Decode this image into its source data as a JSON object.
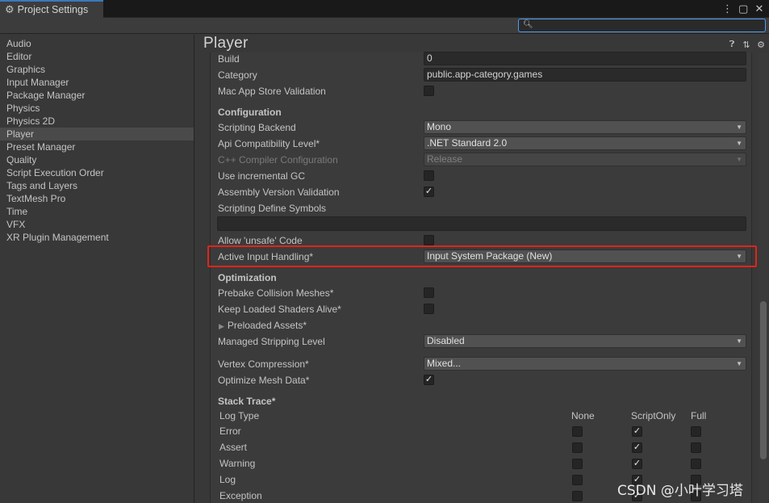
{
  "window": {
    "tab_title": "Project Settings",
    "tab_icon": "gear-icon",
    "controls": [
      "more-icon",
      "maximize-icon",
      "close-icon"
    ]
  },
  "search": {
    "value": "",
    "placeholder": ""
  },
  "sidebar": {
    "items": [
      {
        "label": "Audio"
      },
      {
        "label": "Editor"
      },
      {
        "label": "Graphics"
      },
      {
        "label": "Input Manager"
      },
      {
        "label": "Package Manager"
      },
      {
        "label": "Physics"
      },
      {
        "label": "Physics 2D"
      },
      {
        "label": "Player",
        "selected": true
      },
      {
        "label": "Preset Manager"
      },
      {
        "label": "Quality"
      },
      {
        "label": "Script Execution Order"
      },
      {
        "label": "Tags and Layers"
      },
      {
        "label": "TextMesh Pro"
      },
      {
        "label": "Time"
      },
      {
        "label": "VFX"
      },
      {
        "label": "XR Plugin Management"
      }
    ]
  },
  "main": {
    "title": "Player",
    "header_icons": [
      "help-icon",
      "preset-icon",
      "settings-icon"
    ],
    "build": {
      "label": "Build",
      "value": "0"
    },
    "category": {
      "label": "Category",
      "value": "public.app-category.games"
    },
    "mac_app_store": {
      "label": "Mac App Store Validation",
      "checked": false
    },
    "configuration": {
      "header": "Configuration",
      "scripting_backend": {
        "label": "Scripting Backend",
        "value": "Mono"
      },
      "api_level": {
        "label": "Api Compatibility Level*",
        "value": ".NET Standard 2.0"
      },
      "cpp_config": {
        "label": "C++ Compiler Configuration",
        "value": "Release",
        "disabled": true
      },
      "incremental_gc": {
        "label": "Use incremental GC",
        "checked": false
      },
      "assembly_validation": {
        "label": "Assembly Version Validation",
        "checked": true
      },
      "define_symbols": {
        "label": "Scripting Define Symbols",
        "value": ""
      },
      "allow_unsafe": {
        "label": "Allow 'unsafe' Code",
        "checked": false
      },
      "active_input": {
        "label": "Active Input Handling*",
        "value": "Input System Package (New)"
      }
    },
    "optimization": {
      "header": "Optimization",
      "prebake": {
        "label": "Prebake Collision Meshes*",
        "checked": false
      },
      "keep_shaders": {
        "label": "Keep Loaded Shaders Alive*",
        "checked": false
      },
      "preloaded_assets": {
        "label": "Preloaded Assets*"
      },
      "stripping": {
        "label": "Managed Stripping Level",
        "value": "Disabled"
      },
      "vertex_compression": {
        "label": "Vertex Compression*",
        "value": "Mixed..."
      },
      "optimize_mesh": {
        "label": "Optimize Mesh Data*",
        "checked": true
      }
    },
    "stack_trace": {
      "header": "Stack Trace*",
      "col_log_type": "Log Type",
      "col_none": "None",
      "col_script_only": "ScriptOnly",
      "col_full": "Full",
      "rows": [
        {
          "type": "Error",
          "none": false,
          "script_only": true,
          "full": false
        },
        {
          "type": "Assert",
          "none": false,
          "script_only": true,
          "full": false
        },
        {
          "type": "Warning",
          "none": false,
          "script_only": true,
          "full": false
        },
        {
          "type": "Log",
          "none": false,
          "script_only": true,
          "full": false
        },
        {
          "type": "Exception",
          "none": false,
          "script_only": true,
          "full": false
        }
      ]
    }
  },
  "watermark": "CSDN @小叶学习塔",
  "colors": {
    "accent": "#3a79bb",
    "highlight": "#e0241b",
    "selected": "#4a4a4a"
  }
}
